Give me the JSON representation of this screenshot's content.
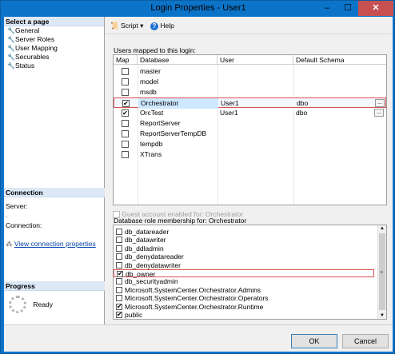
{
  "window": {
    "title": "Login Properties - User1",
    "min": "–",
    "max": "☐",
    "close": "✕"
  },
  "left": {
    "select_page": "Select a page",
    "pages": [
      "General",
      "Server Roles",
      "User Mapping",
      "Securables",
      "Status"
    ],
    "connection_header": "Connection",
    "server_label": "Server:",
    "server_value": ".",
    "connection_label": "Connection:",
    "view_connection": "View connection properties",
    "progress_header": "Progress",
    "progress_status": "Ready"
  },
  "toolbar": {
    "script": "Script",
    "help": "Help"
  },
  "users_label": "Users mapped to this login:",
  "grid": {
    "headers": [
      "Map",
      "Database",
      "User",
      "Default Schema"
    ],
    "rows": [
      {
        "checked": false,
        "database": "master",
        "user": "",
        "schema": ""
      },
      {
        "checked": false,
        "database": "model",
        "user": "",
        "schema": ""
      },
      {
        "checked": false,
        "database": "msdb",
        "user": "",
        "schema": ""
      },
      {
        "checked": true,
        "database": "Orchestrator",
        "user": "User1",
        "schema": "dbo"
      },
      {
        "checked": true,
        "database": "OrcTest",
        "user": "User1",
        "schema": "dbo"
      },
      {
        "checked": false,
        "database": "ReportServer",
        "user": "",
        "schema": ""
      },
      {
        "checked": false,
        "database": "ReportServerTempDB",
        "user": "",
        "schema": ""
      },
      {
        "checked": false,
        "database": "tempdb",
        "user": "",
        "schema": ""
      },
      {
        "checked": false,
        "database": "XTrans",
        "user": "",
        "schema": ""
      }
    ],
    "ellipsis": "..."
  },
  "guest_label": "Guest account enabled for: Orchestrator",
  "roles_label": "Database role membership for: Orchestrator",
  "roles": [
    {
      "checked": false,
      "name": "db_datareader"
    },
    {
      "checked": false,
      "name": "db_datawriter"
    },
    {
      "checked": false,
      "name": "db_ddladmin"
    },
    {
      "checked": false,
      "name": "db_denydatareader"
    },
    {
      "checked": false,
      "name": "db_denydatawriter"
    },
    {
      "checked": true,
      "name": "db_owner"
    },
    {
      "checked": false,
      "name": "db_securityadmin"
    },
    {
      "checked": false,
      "name": "Microsoft.SystemCenter.Orchestrator.Admins"
    },
    {
      "checked": false,
      "name": "Microsoft.SystemCenter.Orchestrator.Operators"
    },
    {
      "checked": true,
      "name": "Microsoft.SystemCenter.Orchestrator.Runtime"
    },
    {
      "checked": true,
      "name": "public"
    }
  ],
  "buttons": {
    "ok": "OK",
    "cancel": "Cancel"
  }
}
